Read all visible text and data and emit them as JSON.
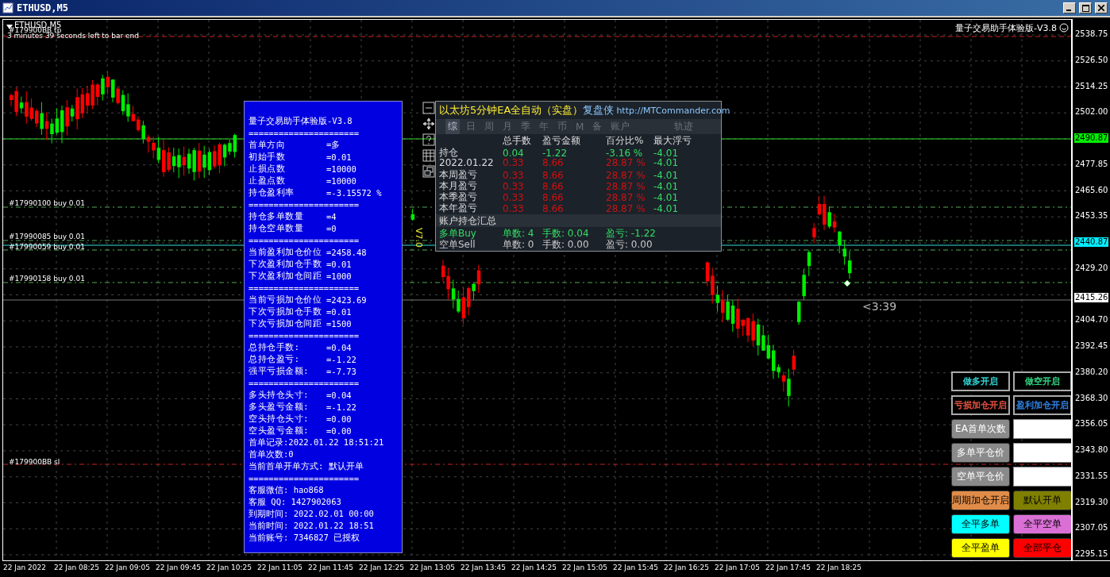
{
  "window": {
    "title": "ETHUSD,M5"
  },
  "chart": {
    "symbol": "ETHUSD,M5",
    "countdown": "3 minutes 39 seconds left to bar end",
    "brand": "量子交易助手体验版-V3.8",
    "timer": "<3:39",
    "version_tag": "V7.0",
    "order_labels": [
      "#179900BB tp",
      "#17990100 buy 0.01",
      "#17990085 buy 0.01",
      "#17990059 buy 0.01",
      "#17990158 buy 0.01",
      "#179900BB sl"
    ]
  },
  "price_axis": [
    {
      "text": "2538.75",
      "kind": "plain"
    },
    {
      "text": "2526.50",
      "kind": "plain"
    },
    {
      "text": "2514.25",
      "kind": "plain"
    },
    {
      "text": "2502.00",
      "kind": "plain"
    },
    {
      "text": "2490.87",
      "kind": "green"
    },
    {
      "text": "2477.85",
      "kind": "plain"
    },
    {
      "text": "2465.60",
      "kind": "plain"
    },
    {
      "text": "2453.35",
      "kind": "plain"
    },
    {
      "text": "2440.87",
      "kind": "cyan"
    },
    {
      "text": "2429.20",
      "kind": "plain"
    },
    {
      "text": "2415.26",
      "kind": "white"
    },
    {
      "text": "2404.70",
      "kind": "plain"
    },
    {
      "text": "2392.45",
      "kind": "plain"
    },
    {
      "text": "2380.20",
      "kind": "plain"
    },
    {
      "text": "2368.30",
      "kind": "plain"
    },
    {
      "text": "2356.05",
      "kind": "plain"
    },
    {
      "text": "2343.80",
      "kind": "plain"
    },
    {
      "text": "2331.55",
      "kind": "plain"
    },
    {
      "text": "2319.30",
      "kind": "plain"
    },
    {
      "text": "2307.05",
      "kind": "plain"
    },
    {
      "text": "2295.15",
      "kind": "plain"
    }
  ],
  "time_axis": [
    "22 Jan 2022",
    "22 Jan 08:25",
    "22 Jan 09:05",
    "22 Jan 09:45",
    "22 Jan 10:25",
    "22 Jan 11:05",
    "22 Jan 11:45",
    "22 Jan 12:25",
    "22 Jan 13:05",
    "22 Jan 13:45",
    "22 Jan 14:25",
    "22 Jan 15:05",
    "22 Jan 15:45",
    "22 Jan 16:25",
    "22 Jan 17:05",
    "22 Jan 17:45",
    "22 Jan 18:25"
  ],
  "info_panel": {
    "title": "量子交易助手体验版-V3.8",
    "lines": [
      {
        "kind": "rule",
        "text": "======================"
      },
      {
        "kind": "pair",
        "label": "首单方向",
        "value": "=多"
      },
      {
        "kind": "pair",
        "label": "初始手数",
        "value": "=0.01"
      },
      {
        "kind": "pair",
        "label": "止损点数",
        "value": "=10000"
      },
      {
        "kind": "pair",
        "label": "止盈点数",
        "value": "=10000"
      },
      {
        "kind": "pair",
        "label": "持仓盈利率",
        "value": "=-3.15572 %"
      },
      {
        "kind": "rule",
        "text": "======================"
      },
      {
        "kind": "pair",
        "label": "持仓多单数量",
        "value": "=4"
      },
      {
        "kind": "pair",
        "label": "持仓空单数量",
        "value": "=0"
      },
      {
        "kind": "rule",
        "text": "======================"
      },
      {
        "kind": "pair",
        "label": "当前盈利加仓价位",
        "value": "=2458.48"
      },
      {
        "kind": "pair",
        "label": "下次盈利加仓手数",
        "value": "=0.01"
      },
      {
        "kind": "pair",
        "label": "下次盈利加仓间距",
        "value": "=1000"
      },
      {
        "kind": "rule",
        "text": "======================"
      },
      {
        "kind": "pair",
        "label": "当前亏损加仓价位",
        "value": "=2423.69"
      },
      {
        "kind": "pair",
        "label": "下次亏损加仓手数",
        "value": "=0.01"
      },
      {
        "kind": "pair",
        "label": "下次亏损加仓间距",
        "value": "=1500"
      },
      {
        "kind": "rule",
        "text": "======================"
      },
      {
        "kind": "pair",
        "label": "总持仓手数:",
        "value": "=0.04"
      },
      {
        "kind": "pair",
        "label": "总持仓盈亏:",
        "value": "=-1.22"
      },
      {
        "kind": "pair",
        "label": "强平亏损金额:",
        "value": "=-7.73"
      },
      {
        "kind": "rule",
        "text": "======================"
      },
      {
        "kind": "pair",
        "label": "多头持仓头寸:",
        "value": "=0.04"
      },
      {
        "kind": "pair",
        "label": "多头盈亏金额:",
        "value": "=-1.22"
      },
      {
        "kind": "pair",
        "label": "空头持仓头寸:",
        "value": "=0.00"
      },
      {
        "kind": "pair",
        "label": "空头盈亏金额:",
        "value": "=0.00"
      },
      {
        "kind": "line",
        "text": "首单记录:2022.01.22 18:51:21"
      },
      {
        "kind": "line",
        "text": "首单次数:0"
      },
      {
        "kind": "line",
        "text": "当前首单开单方式: 默认开单"
      },
      {
        "kind": "rule",
        "text": "======================"
      },
      {
        "kind": "line",
        "text": "客服微信: hao868"
      },
      {
        "kind": "line",
        "text": "客服 QQ:  1427902063"
      },
      {
        "kind": "line",
        "text": "到期时间: 2022.02.01 00:00"
      },
      {
        "kind": "line",
        "text": "当前时间: 2022.01.22 18:51"
      },
      {
        "kind": "line",
        "text": "当前账号: 7346827 已授权"
      }
    ]
  },
  "stats_panel": {
    "title": "以太坊5分钟EA全自动（实盘）",
    "link_label": "复盘侠",
    "url": "http://MTCommander.com",
    "tabs": [
      {
        "label": "综",
        "selected": true
      },
      {
        "label": "日",
        "selected": false
      },
      {
        "label": "周",
        "selected": false
      },
      {
        "label": "月",
        "selected": false
      },
      {
        "label": "季",
        "selected": false
      },
      {
        "label": "年",
        "selected": false
      },
      {
        "label": "币",
        "selected": false
      },
      {
        "label": "M",
        "selected": false
      },
      {
        "label": "备",
        "selected": false
      },
      {
        "label": "账户",
        "selected": false
      },
      {
        "label": "轨迹",
        "selected": false
      }
    ],
    "columns": [
      "总手数",
      "盈亏金额",
      "百分比%",
      "最大浮亏"
    ],
    "rows": [
      {
        "label": "持仓",
        "cells": [
          {
            "text": "0.04",
            "color": "#33dd66"
          },
          {
            "text": "-1.22",
            "color": "#33dd66"
          },
          {
            "text": "-3.16 %",
            "color": "#33dd66"
          },
          {
            "text": "-4.01",
            "color": "#33dd66"
          }
        ]
      },
      {
        "label": "2022.01.22",
        "cells": [
          {
            "text": "0.33",
            "color": "#cc1111"
          },
          {
            "text": "8.66",
            "color": "#cc1111"
          },
          {
            "text": "28.87 %",
            "color": "#cc1111"
          },
          {
            "text": "-4.01",
            "color": "#33dd66"
          }
        ]
      },
      {
        "label": "本周盈亏",
        "cells": [
          {
            "text": "0.33",
            "color": "#cc1111"
          },
          {
            "text": "8.66",
            "color": "#cc1111"
          },
          {
            "text": "28.87 %",
            "color": "#cc1111"
          },
          {
            "text": "-4.01",
            "color": "#33dd66"
          }
        ]
      },
      {
        "label": "本月盈亏",
        "cells": [
          {
            "text": "0.33",
            "color": "#cc1111"
          },
          {
            "text": "8.66",
            "color": "#cc1111"
          },
          {
            "text": "28.87 %",
            "color": "#cc1111"
          },
          {
            "text": "-4.01",
            "color": "#33dd66"
          }
        ]
      },
      {
        "label": "本季盈亏",
        "cells": [
          {
            "text": "0.33",
            "color": "#cc1111"
          },
          {
            "text": "8.66",
            "color": "#cc1111"
          },
          {
            "text": "28.87 %",
            "color": "#cc1111"
          },
          {
            "text": "-4.01",
            "color": "#33dd66"
          }
        ]
      },
      {
        "label": "本年盈亏",
        "cells": [
          {
            "text": "0.33",
            "color": "#cc1111"
          },
          {
            "text": "8.66",
            "color": "#cc1111"
          },
          {
            "text": "28.87 %",
            "color": "#cc1111"
          },
          {
            "text": "-4.01",
            "color": "#33dd66"
          }
        ]
      }
    ],
    "summary_title": "账户持仓汇总",
    "summary": [
      {
        "label": "多单Buy",
        "count": "单数: 4",
        "lots": "手数: 0.04",
        "pnl": "盈亏: -1.22",
        "color": "#33dd66"
      },
      {
        "label": "空单Sell",
        "count": "单数: 0",
        "lots": "手数: 0.00",
        "pnl": "盈亏: 0.00",
        "color": "#c8c8c8"
      }
    ]
  },
  "controls": [
    {
      "kind": "toggle",
      "label": "做多开启",
      "color": "#33dddd"
    },
    {
      "kind": "toggle",
      "label": "做空开启",
      "color": "#33dd88"
    },
    {
      "kind": "toggle",
      "label": "亏损加仓开启",
      "color": "#ee5544"
    },
    {
      "kind": "toggle",
      "label": "盈利加仓开启",
      "color": "#3388ee"
    },
    {
      "kind": "label",
      "label": "EA首单次数",
      "color": "#8a8a8a"
    },
    {
      "kind": "field"
    },
    {
      "kind": "label",
      "label": "多单平仓价",
      "color": "#8a8a8a"
    },
    {
      "kind": "field"
    },
    {
      "kind": "label",
      "label": "空单平仓价",
      "color": "#8a8a8a"
    },
    {
      "kind": "field"
    },
    {
      "kind": "action",
      "label": "周期加仓开启",
      "color": "#e08c48"
    },
    {
      "kind": "action",
      "label": "默认开单",
      "color": "#808000"
    },
    {
      "kind": "action",
      "label": "全平多单",
      "color": "#00ffff"
    },
    {
      "kind": "action",
      "label": "全平空单",
      "color": "#da70d6"
    },
    {
      "kind": "action",
      "label": "全平盈单",
      "color": "#ffff00"
    },
    {
      "kind": "action",
      "label": "全部平仓",
      "color": "#ff0000"
    }
  ]
}
